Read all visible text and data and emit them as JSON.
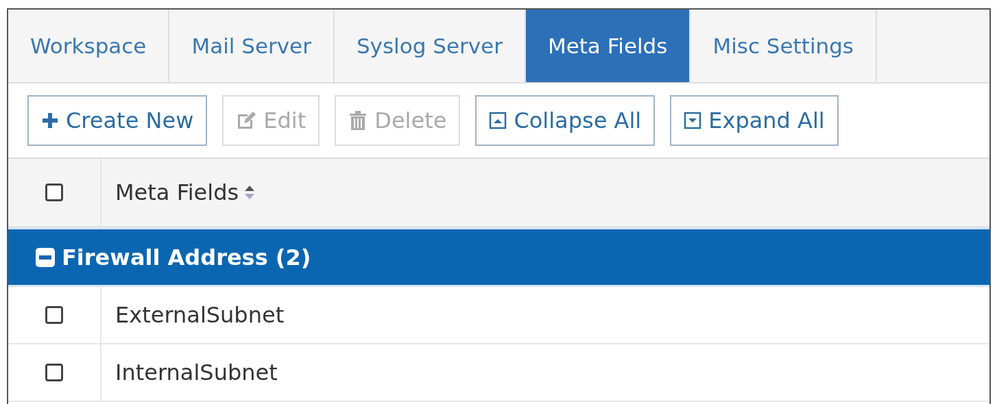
{
  "tabs": [
    {
      "label": "Workspace",
      "selected": false
    },
    {
      "label": "Mail Server",
      "selected": false
    },
    {
      "label": "Syslog Server",
      "selected": false
    },
    {
      "label": "Meta Fields",
      "selected": true
    },
    {
      "label": "Misc Settings",
      "selected": false
    }
  ],
  "toolbar": [
    {
      "kind": "create",
      "label": "Create New",
      "disabled": false
    },
    {
      "kind": "edit",
      "label": "Edit",
      "disabled": true
    },
    {
      "kind": "delete",
      "label": "Delete",
      "disabled": true
    },
    {
      "kind": "collapse",
      "label": "Collapse All",
      "disabled": false
    },
    {
      "kind": "expand",
      "label": "Expand All",
      "disabled": false
    }
  ],
  "table": {
    "header_checked": false,
    "columns": [
      {
        "label": "Meta Fields",
        "sortable": true
      }
    ],
    "groups": [
      {
        "label": "Firewall Address (2)",
        "expanded": true,
        "rows": [
          {
            "name": "ExternalSubnet",
            "checked": false
          },
          {
            "name": "InternalSubnet",
            "checked": false
          }
        ]
      }
    ]
  }
}
